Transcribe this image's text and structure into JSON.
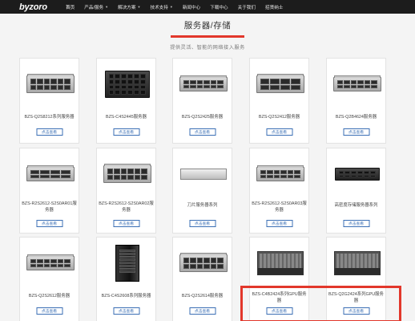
{
  "logo": "byzoro",
  "nav": [
    {
      "label": "首页",
      "dropdown": false
    },
    {
      "label": "产品/服务",
      "dropdown": true
    },
    {
      "label": "解决方案",
      "dropdown": true
    },
    {
      "label": "技术支持",
      "dropdown": true
    },
    {
      "label": "新闻中心",
      "dropdown": false
    },
    {
      "label": "下载中心",
      "dropdown": false
    },
    {
      "label": "关于我们",
      "dropdown": false
    },
    {
      "label": "招贤纳士",
      "dropdown": false
    }
  ],
  "section": {
    "title": "服务器/存储",
    "subtitle": "提供灵活、智能的网络接入服务"
  },
  "products": [
    {
      "name": "BZS-Q2S8212系列服务器",
      "button": "点击查看",
      "icon": "rack-server-icon"
    },
    {
      "name": "BZS-C4S2445服务器",
      "button": "点击查看",
      "icon": "dark-storage-server-icon"
    },
    {
      "name": "BZS-Q2S2425服务器",
      "button": "点击查看",
      "icon": "rack-server-icon"
    },
    {
      "name": "BZS-Q2S2412服务器",
      "button": "点击查看",
      "icon": "rack-server-icon"
    },
    {
      "name": "BZS-Q2B4624服务器",
      "button": "点击查看",
      "icon": "rack-server-icon"
    },
    {
      "name": "BZS-R2S2612-S2S0AR01服务器",
      "button": "点击查看",
      "icon": "rack-server-icon"
    },
    {
      "name": "BZS-R2S2612-S2S0AR02服务器",
      "button": "点击查看",
      "icon": "rack-server-icon"
    },
    {
      "name": "刀片服务器系列",
      "button": "点击查看",
      "icon": "blade-server-icon"
    },
    {
      "name": "BZS-R2S2612-S2S0AR03服务器",
      "button": "点击查看",
      "icon": "rack-server-icon"
    },
    {
      "name": "高密度存储服务器系列",
      "button": "点击查看",
      "icon": "dark-storage-server-icon"
    },
    {
      "name": "BZS-Q2S2612服务器",
      "button": "点击查看",
      "icon": "rack-server-icon"
    },
    {
      "name": "BZS-C4S2608系列服务器",
      "button": "点击查看",
      "icon": "tower-server-icon"
    },
    {
      "name": "BZS-Q2S2614服务器",
      "button": "点击查看",
      "icon": "rack-server-icon"
    },
    {
      "name": "BZS-C4B2424系列GPU服务器",
      "button": "点击查看",
      "icon": "gpu-server-icon"
    },
    {
      "name": "BZS-Q2G2424系列GPU服务器",
      "button": "点击查看",
      "icon": "gpu-server-icon"
    }
  ]
}
